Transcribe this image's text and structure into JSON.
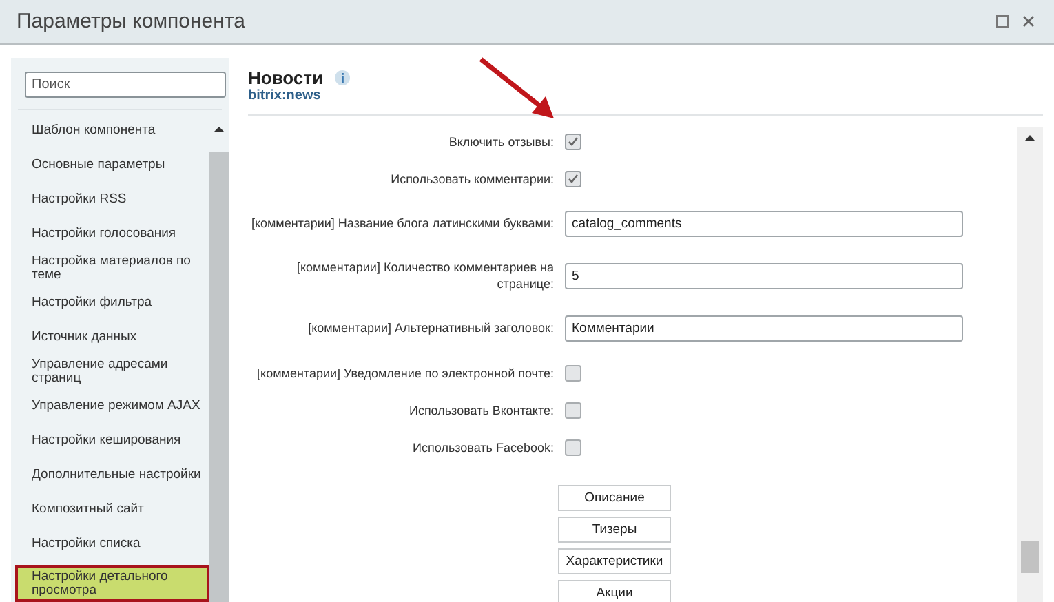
{
  "window": {
    "title": "Параметры компонента"
  },
  "sidebar": {
    "search": {
      "placeholder": "Поиск"
    },
    "items": [
      {
        "label": "Шаблон компонента",
        "selected": false
      },
      {
        "label": "Основные параметры",
        "selected": false
      },
      {
        "label": "Настройки RSS",
        "selected": false
      },
      {
        "label": "Настройки голосования",
        "selected": false
      },
      {
        "label": "Настройка материалов по теме",
        "selected": false
      },
      {
        "label": "Настройки фильтра",
        "selected": false
      },
      {
        "label": "Источник данных",
        "selected": false
      },
      {
        "label": "Управление адресами страниц",
        "selected": false
      },
      {
        "label": "Управление режимом AJAX",
        "selected": false
      },
      {
        "label": "Настройки кеширования",
        "selected": false
      },
      {
        "label": "Дополнительные настройки",
        "selected": false
      },
      {
        "label": "Композитный сайт",
        "selected": false
      },
      {
        "label": "Настройки списка",
        "selected": false
      },
      {
        "label": "Настройки детального просмотра",
        "selected": true
      }
    ]
  },
  "component": {
    "title": "Новости",
    "code": "bitrix:news"
  },
  "fields": [
    {
      "kind": "checkbox",
      "label": "Включить отзывы:",
      "checked": true
    },
    {
      "kind": "checkbox",
      "label": "Использовать комментарии:",
      "checked": true
    },
    {
      "kind": "text",
      "label": "[комментарии] Название блога латинскими буквами:",
      "value": "catalog_comments"
    },
    {
      "kind": "text",
      "label": "[комментарии] Количество комментариев на странице:",
      "value": "5"
    },
    {
      "kind": "text",
      "label": "[комментарии] Альтернативный заголовок:",
      "value": "Комментарии"
    },
    {
      "kind": "checkbox",
      "label": "[комментарии] Уведомление по электронной почте:",
      "checked": false
    },
    {
      "kind": "checkbox",
      "label": "Использовать Вконтакте:",
      "checked": false
    },
    {
      "kind": "checkbox",
      "label": "Использовать Facebook:",
      "checked": false
    }
  ],
  "buttons": [
    "Описание",
    "Тизеры",
    "Характеристики",
    "Акции"
  ]
}
